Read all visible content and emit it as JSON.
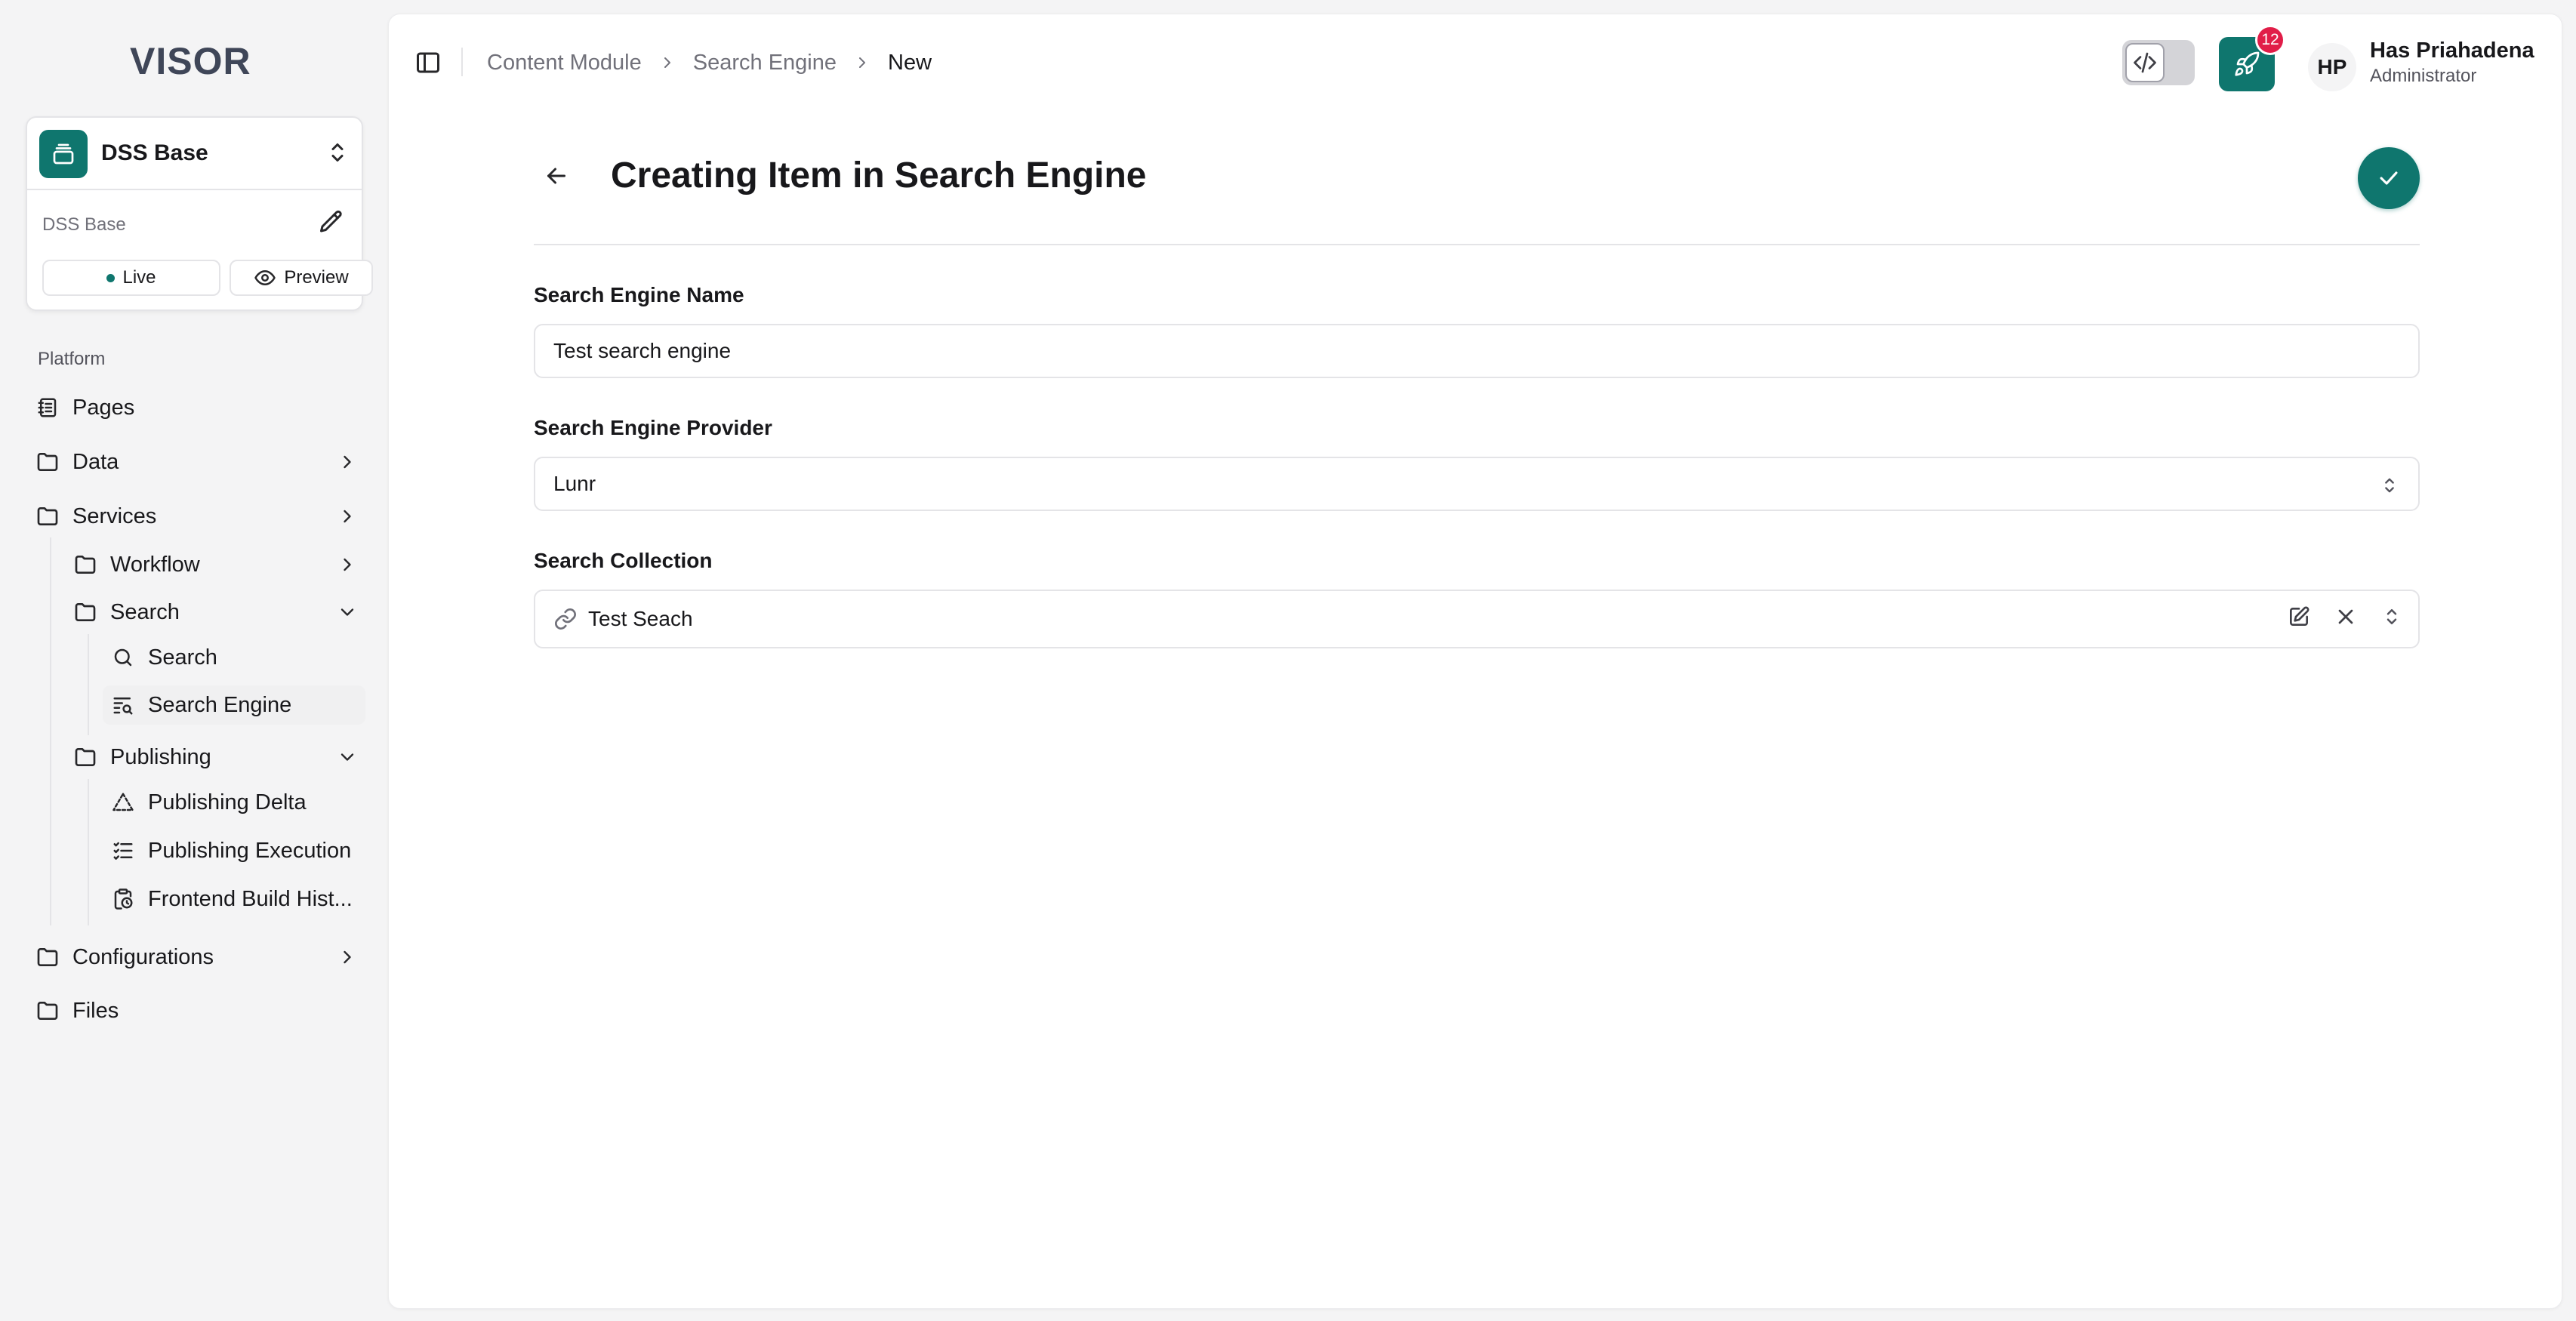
{
  "app": {
    "logo_text": "VISOR"
  },
  "project": {
    "name": "DSS Base",
    "subtitle": "DSS Base",
    "live_label": "Live",
    "preview_label": "Preview"
  },
  "sidebar": {
    "group_label": "Platform",
    "items": {
      "pages": "Pages",
      "data": "Data",
      "services": "Services",
      "workflow": "Workflow",
      "search_folder": "Search",
      "search": "Search",
      "search_engine": "Search Engine",
      "publishing": "Publishing",
      "publishing_delta": "Publishing Delta",
      "publishing_execution": "Publishing Execution",
      "frontend_build": "Frontend Build Hist...",
      "configurations": "Configurations",
      "files": "Files"
    }
  },
  "breadcrumb": {
    "level1": "Content Module",
    "level2": "Search Engine",
    "current": "New"
  },
  "header": {
    "notification_count": "12",
    "user_initials": "HP",
    "user_name": "Has Priahadena",
    "user_role": "Administrator"
  },
  "page": {
    "title": "Creating Item in Search Engine"
  },
  "form": {
    "name_label": "Search Engine Name",
    "name_value": "Test search engine",
    "provider_label": "Search Engine Provider",
    "provider_value": "Lunr",
    "collection_label": "Search Collection",
    "collection_value": "Test Seach"
  },
  "colors": {
    "accent": "#0f766e",
    "badge": "#e11d48"
  }
}
